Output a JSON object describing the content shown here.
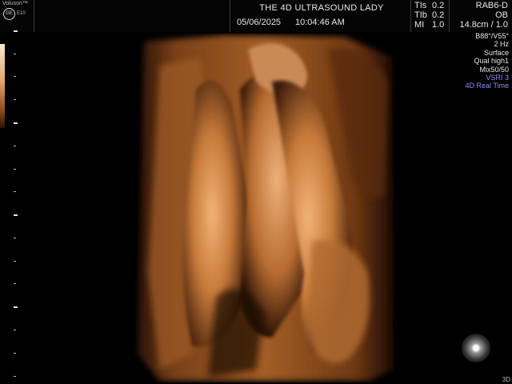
{
  "header": {
    "brand": "Voluson™",
    "ge_logo": "GE",
    "model": "E10",
    "title": "THE 4D ULTRASOUND LADY",
    "date": "05/06/2025",
    "time": "10:04:46 AM"
  },
  "indices": [
    {
      "label": "TIs",
      "value": "0.2"
    },
    {
      "label": "TIb",
      "value": "0.2"
    },
    {
      "label": "MI",
      "value": "1.0"
    }
  ],
  "probe": {
    "name": "RAB6-D",
    "preset": "OB",
    "depth": "14.8cm / 1.0"
  },
  "params": [
    "B88°/V55°",
    "2 Hz",
    "Surface",
    "Qual high1",
    "Mix50/50"
  ],
  "params_highlight": [
    "VSRI 3",
    "4D Real Time"
  ],
  "highlight_color": "#8d8dff",
  "corner_label": "3D",
  "icons": {
    "trackball": "trackball-cursor-icon",
    "logo": "ge-logo-icon"
  }
}
